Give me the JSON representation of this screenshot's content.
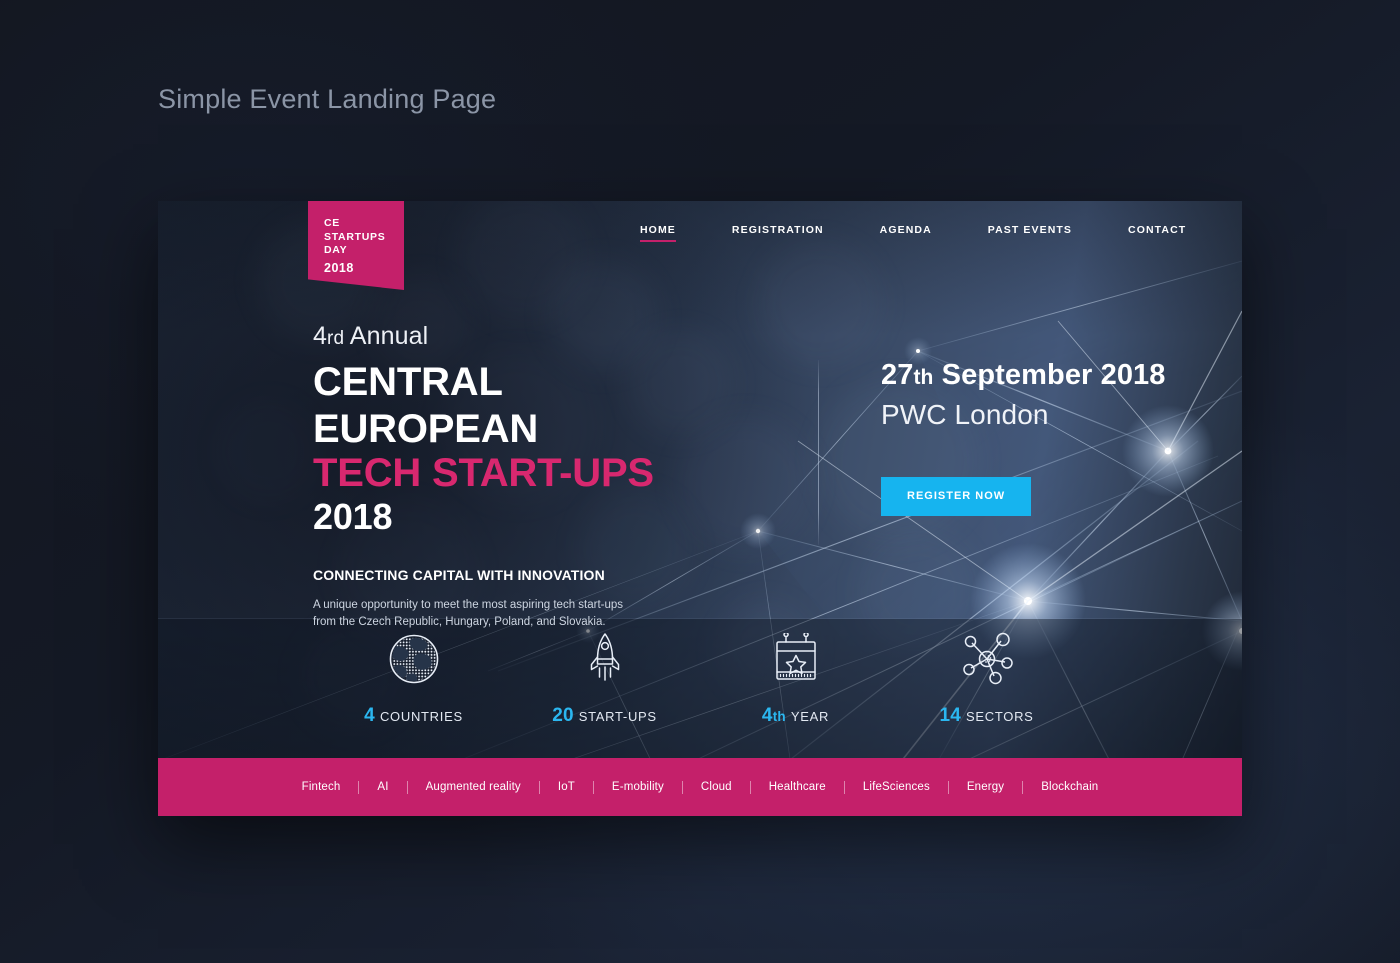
{
  "page": {
    "caption": "Simple Event Landing Page"
  },
  "logo": {
    "line1": "CE",
    "line2": "STARTUPS",
    "line3": "DAY",
    "year": "2018"
  },
  "nav": {
    "items": [
      {
        "label": "HOME",
        "active": true
      },
      {
        "label": "REGISTRATION",
        "active": false
      },
      {
        "label": "AGENDA",
        "active": false
      },
      {
        "label": "PAST EVENTS",
        "active": false
      },
      {
        "label": "CONTACT",
        "active": false
      }
    ]
  },
  "hero": {
    "pretitle_num": "4",
    "pretitle_ord": "rd",
    "pretitle_rest": " Annual",
    "title_line1": "CENTRAL EUROPEAN",
    "title_line2": "TECH START-UPS",
    "title_line3": "2018",
    "tagline": "CONNECTING CAPITAL WITH INNOVATION",
    "blurb_line1": "A unique opportunity to meet the most aspiring tech start-ups",
    "blurb_line2": "from the Czech Republic, Hungary, Poland, and Slovakia.",
    "date_day": "27",
    "date_ord": "th",
    "date_rest": " September 2018",
    "venue": "PWC London",
    "cta_label": "REGISTER NOW"
  },
  "stats": [
    {
      "icon": "globe-icon",
      "number": "4",
      "ordinal": "",
      "word": "COUNTRIES"
    },
    {
      "icon": "rocket-icon",
      "number": "20",
      "ordinal": "",
      "word": "START-UPS"
    },
    {
      "icon": "calendar-star-icon",
      "number": "4",
      "ordinal": "th",
      "word": "YEAR"
    },
    {
      "icon": "network-icon",
      "number": "14",
      "ordinal": "",
      "word": "SECTORS"
    }
  ],
  "tags": [
    "Fintech",
    "AI",
    "Augmented reality",
    "IoT",
    "E-mobility",
    "Cloud",
    "Healthcare",
    "LifeSciences",
    "Energy",
    "Blockchain"
  ],
  "colors": {
    "brand_pink": "#c4206a",
    "title_pink": "#d8286f",
    "cta_blue": "#16b4ef",
    "stat_blue": "#2bb7f0",
    "page_bg": "#13161f"
  }
}
